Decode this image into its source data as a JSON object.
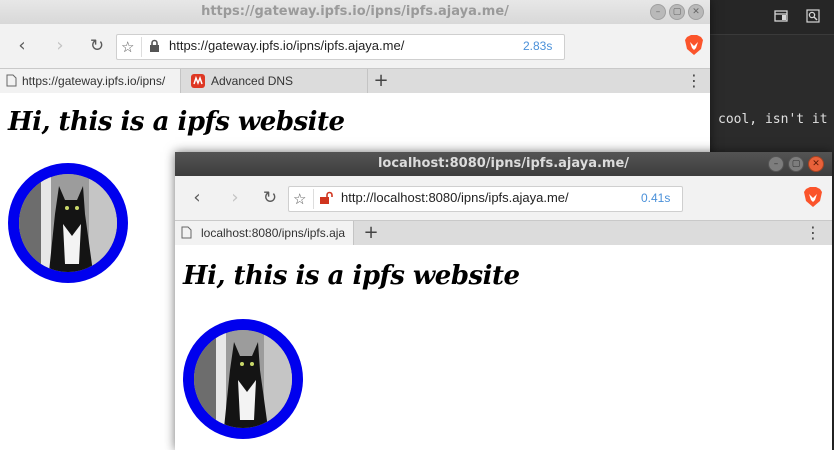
{
  "terminal": {
    "text": "cool, isn't it",
    "icons": [
      "panel-icon",
      "search-icon"
    ]
  },
  "back_window": {
    "title": "https://gateway.ipfs.io/ipns/ipfs.ajaya.me/",
    "url": "https://gateway.ipfs.io/ipns/ipfs.ajaya.me/",
    "load_time": "2.83s",
    "tabs": [
      {
        "label": "https://gateway.ipfs.io/ipns/"
      },
      {
        "label": "Advanced DNS"
      }
    ],
    "new_tab": "+",
    "menu": "⋮"
  },
  "front_window": {
    "title": "localhost:8080/ipns/ipfs.ajaya.me/",
    "url": "http://localhost:8080/ipns/ipfs.ajaya.me/",
    "load_time": "0.41s",
    "tabs": [
      {
        "label": "localhost:8080/ipns/ipfs.aja"
      }
    ],
    "new_tab": "+",
    "menu": "⋮"
  },
  "page": {
    "heading": "Hi, this is a ipfs website",
    "image_subject": "cat-in-tuxedo-avatar"
  },
  "colors": {
    "avatar_ring": "#0000ee",
    "load_time": "#4a90d9",
    "close_button": "#e8613a",
    "dark_titlebar": "#454545"
  }
}
